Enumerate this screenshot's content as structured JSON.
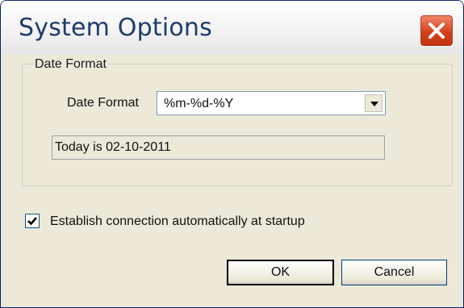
{
  "window": {
    "title": "System Options",
    "close_icon": "close-icon"
  },
  "date_group": {
    "legend": "Date Format",
    "label": "Date Format",
    "select_value": "%m-%d-%Y",
    "preview_text": "Today is 02-10-2011"
  },
  "startup": {
    "checked": true,
    "label": "Establish connection automatically at startup"
  },
  "buttons": {
    "ok": "OK",
    "cancel": "Cancel"
  }
}
